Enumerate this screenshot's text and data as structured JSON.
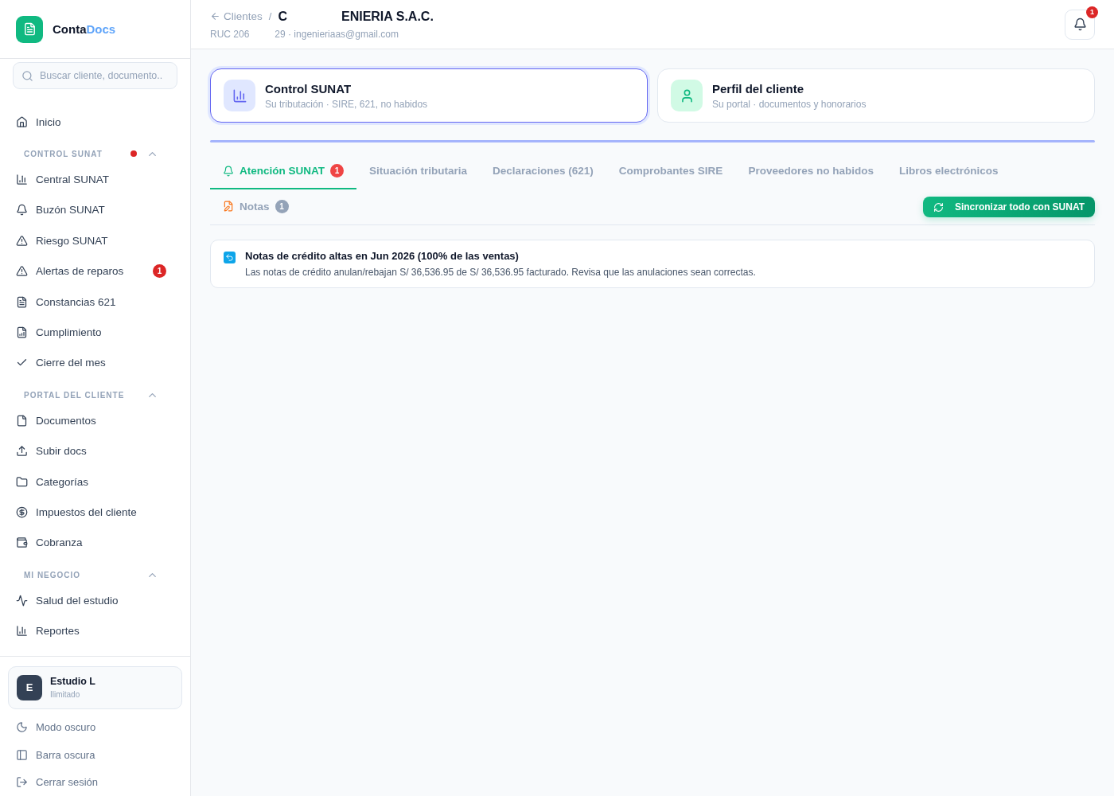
{
  "brand": {
    "name_1": "Conta",
    "name_2": "Docs"
  },
  "search": {
    "placeholder": "Buscar cliente, documento.."
  },
  "nav": [
    {
      "kind": "link",
      "label": "Inicio",
      "selected": false
    },
    {
      "kind": "section",
      "label": "CONTROL SUNAT",
      "alert": true,
      "expanded": true,
      "items": [
        {
          "label": "Central SUNAT"
        },
        {
          "label": "Buzón SUNAT"
        },
        {
          "label": "Riesgo SUNAT"
        },
        {
          "label": "Alertas de reparos",
          "badge": "1"
        },
        {
          "label": "Constancias 621"
        },
        {
          "label": "Cumplimiento"
        },
        {
          "label": "Cierre del mes"
        }
      ]
    },
    {
      "kind": "section",
      "label": "PORTAL DEL CLIENTE",
      "alert": false,
      "expanded": true,
      "items": [
        {
          "label": "Documentos"
        },
        {
          "label": "Subir docs"
        },
        {
          "label": "Categorías"
        },
        {
          "label": "Impuestos del cliente"
        },
        {
          "label": "Cobranza"
        }
      ]
    },
    {
      "kind": "section",
      "label": "MI NEGOCIO",
      "alert": false,
      "expanded": true,
      "items": [
        {
          "label": "Salud del estudio"
        },
        {
          "label": "Reportes"
        }
      ]
    }
  ],
  "account": {
    "initial": "E",
    "name": "Estudio L",
    "plan": "Ilimitado"
  },
  "footer_links": [
    "Modo oscuro",
    "Barra oscura",
    "Cerrar sesión"
  ],
  "header": {
    "back": "Clientes",
    "separator": "/",
    "title_1": "C",
    "title_2": "ENIERIA S.A.C.",
    "ruc": "RUC 206",
    "email": "29 · ingenieriaas@gmail.com",
    "notifications": "1"
  },
  "cards": [
    {
      "title": "Control SUNAT",
      "subtitle": "Su tributación · SIRE, 621, no habidos",
      "selected": true
    },
    {
      "title": "Perfil del cliente",
      "subtitle": "Su portal · documentos y honorarios",
      "selected": false
    }
  ],
  "tabs": [
    {
      "label": "Atención SUNAT",
      "badge": "1",
      "selected": true
    },
    {
      "label": "Situación tributaria",
      "selected": false
    },
    {
      "label": "Declaraciones (621)",
      "selected": false
    },
    {
      "label": "Comprobantes SIRE",
      "selected": false
    },
    {
      "label": "Proveedores no habidos",
      "selected": false
    },
    {
      "label": "Libros electrónicos",
      "selected": false
    },
    {
      "label": "Notas",
      "badge": "1",
      "selected": false
    }
  ],
  "sync_button": "Sincronizar todo con SUNAT",
  "alerts": [
    {
      "title": "Notas de crédito altas en Jun 2026 (100% de las ventas)",
      "body": "Las notas de crédito anulan/rebajan S/ 36,536.95 de S/ 36,536.95 facturado. Revisa que las anulaciones sean correctas."
    }
  ]
}
